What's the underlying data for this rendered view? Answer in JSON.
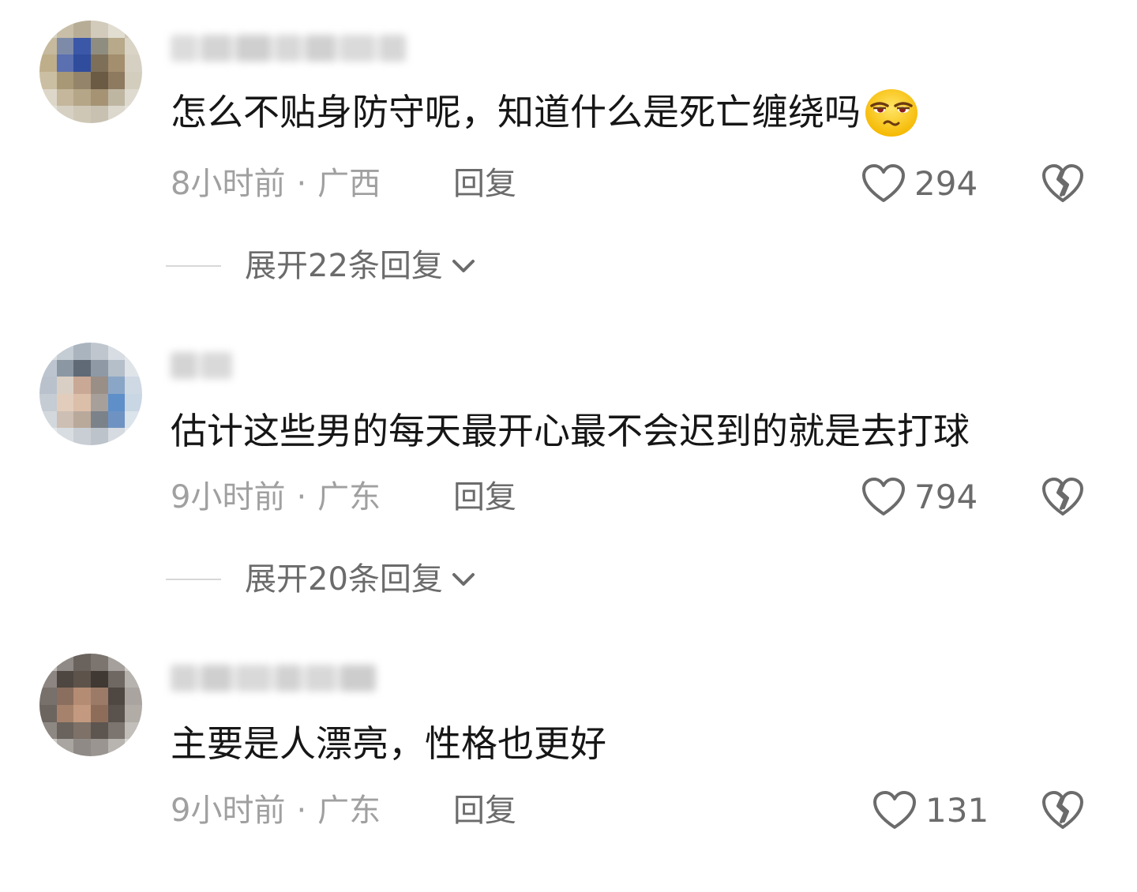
{
  "comments": [
    {
      "avatar_colors": [
        "#d8d2c2",
        "#c9bfa8",
        "#b7ad97",
        "#d2cbbb",
        "#e1ddd1",
        "#cfc8b8",
        "#c6b99d",
        "#7e8ba8",
        "#3b57a8",
        "#8f8d7f",
        "#b7a989",
        "#d9d4c6",
        "#bfae8a",
        "#5b70b0",
        "#2f4d9c",
        "#7e6f58",
        "#a38e6e",
        "#d5d0c2",
        "#cbbfa3",
        "#a99875",
        "#94846a",
        "#6b5a44",
        "#8d7a5f",
        "#d3cdbd",
        "#ddd7c9",
        "#c4b79c",
        "#b5a688",
        "#a59374",
        "#bfb6a2",
        "#dedad0",
        "#e2dfd6",
        "#d6d0c3",
        "#cfc7b6",
        "#c8c1b1",
        "#dcd8cd",
        "#e6e3dc"
      ],
      "username_blocks": [
        "#dcdcdc",
        "#d4d4d4",
        "#cfcfcf",
        "#d8d8d8",
        "#d0d0d0",
        "#dadada",
        "#d6d6d6"
      ],
      "text": "怎么不贴身防守呢，知道什么是死亡缠绕吗",
      "emoji": "smirk-emoji",
      "time": "8小时前",
      "dot": "·",
      "location": "广西",
      "reply": "回复",
      "likes": "294",
      "expand": "展开22条回复"
    },
    {
      "avatar_colors": [
        "#d9dde2",
        "#c4ccd4",
        "#a9b4be",
        "#bfc6cd",
        "#d7dde3",
        "#e3e7eb",
        "#bcc5cf",
        "#8b97a3",
        "#5f6a76",
        "#8e99a5",
        "#b4bfca",
        "#dfe4e9",
        "#b9c2cc",
        "#d9cfc4",
        "#caa896",
        "#9a8f86",
        "#8aa6c6",
        "#cfd9e4",
        "#c5ccd3",
        "#e2cdbd",
        "#dcbfa9",
        "#a7a09a",
        "#5e8fc9",
        "#c9d6e3",
        "#d3d8dd",
        "#cdbfb3",
        "#b9a99b",
        "#7b828a",
        "#6e93c3",
        "#dbe3eb",
        "#e4e8ec",
        "#d8dde2",
        "#c8ced4",
        "#bcc3ca",
        "#d5dbe1",
        "#e8ecef"
      ],
      "username_blocks": [
        "#d4d4d4",
        "#d9d9d9"
      ],
      "text": "估计这些男的每天最开心最不会迟到的就是去打球",
      "emoji": "",
      "time": "9小时前",
      "dot": "·",
      "location": "广东",
      "reply": "回复",
      "likes": "794",
      "expand": "展开20条回复"
    },
    {
      "avatar_colors": [
        "#bdbab6",
        "#8f8a85",
        "#6a625d",
        "#7c746e",
        "#a5a09b",
        "#cfccc8",
        "#8c8581",
        "#4e4640",
        "#5d534b",
        "#3f3833",
        "#6f6761",
        "#b6b2ad",
        "#77706b",
        "#8a6e5e",
        "#b48c74",
        "#9b7b68",
        "#4f4741",
        "#a9a49f",
        "#6c655f",
        "#a6826c",
        "#c39a7f",
        "#8d6d5a",
        "#5a524c",
        "#b1aca6",
        "#8e8883",
        "#6a625c",
        "#7d7168",
        "#5d5550",
        "#7b746f",
        "#c2beba",
        "#cfccc8",
        "#a9a5a1",
        "#8f8a86",
        "#9a9591",
        "#b8b4b0",
        "#dcdad7"
      ],
      "username_blocks": [
        "#d6d6d6",
        "#cfcfcf",
        "#d9d9d9",
        "#d2d2d2",
        "#d8d8d8",
        "#cdcdcd"
      ],
      "text": "主要是人漂亮，性格也更好",
      "emoji": "",
      "time": "9小时前",
      "dot": "·",
      "location": "广东",
      "reply": "回复",
      "likes": "131",
      "expand": ""
    }
  ],
  "colors": {
    "text": "#161616",
    "meta": "#a0a0a0",
    "action": "#6b6b6b",
    "icon_stroke": "#6b6b6b",
    "divider": "#d8d8d8"
  },
  "icons": {
    "like": "heart-outline-icon",
    "dislike": "broken-heart-outline-icon",
    "expand": "chevron-down-icon"
  }
}
